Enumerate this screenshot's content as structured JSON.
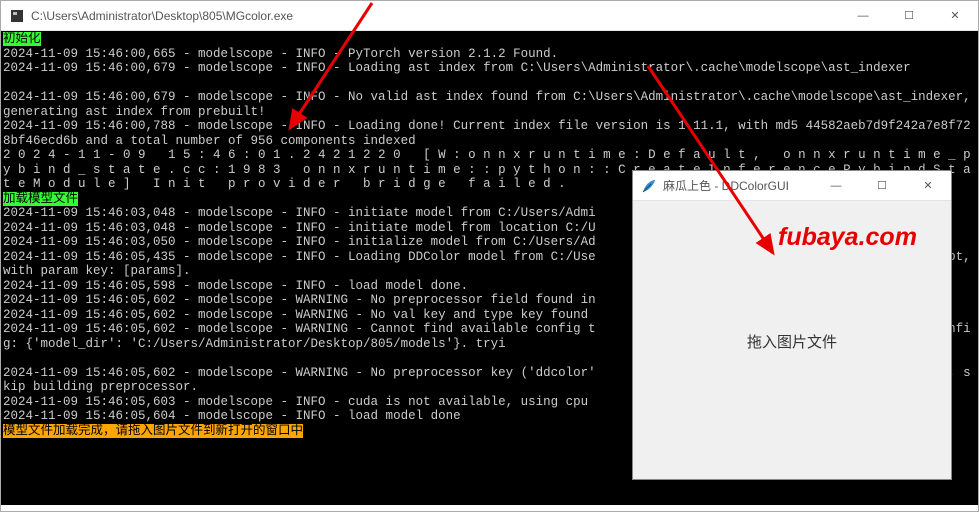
{
  "main_window": {
    "title": "C:\\Users\\Administrator\\Desktop\\805\\MGcolor.exe",
    "controls": {
      "min": "—",
      "max": "☐",
      "close": "✕"
    }
  },
  "console": {
    "hl_init": "初始化",
    "block1": "2024-11-09 15:46:00,665 - modelscope - INFO - PyTorch version 2.1.2 Found.\n2024-11-09 15:46:00,679 - modelscope - INFO - Loading ast index from C:\\Users\\Administrator\\.cache\\modelscope\\ast_indexer\n\n2024-11-09 15:46:00,679 - modelscope - INFO - No valid ast index found from C:\\Users\\Administrator\\.cache\\modelscope\\ast_indexer, generating ast index from prebuilt!\n2024-11-09 15:46:00,788 - modelscope - INFO - Loading done! Current index file version is 1.11.1, with md5 44582aeb7d9f242a7e8f728bf46ecd6b and a total number of 956 components indexed\n2 0 2 4 - 1 1 - 0 9   1 5 : 4 6 : 0 1 . 2 4 2 1 2 2 0   [ W : o n n x r u n t i m e : D e f a u l t ,   o n n x r u n t i m e _ p y b i n d _ s t a t e . c c : 1 9 8 3   o n n x r u n t i m e : : p y t h o n : : C r e a t e I n f e r e n c e P y b i n d S t a t e M o d u l e ]   I n i t   p r o v i d e r   b r i d g e   f a i l e d .",
    "hl_load": "加载模型文件",
    "block2": "2024-11-09 15:46:03,048 - modelscope - INFO - initiate model from C:/Users/Admi\n2024-11-09 15:46:03,048 - modelscope - INFO - initiate model from location C:/U\n2024-11-09 15:46:03,050 - modelscope - INFO - initialize model from C:/Users/Ad\n2024-11-09 15:46:05,435 - modelscope - INFO - Loading DDColor model from C:/Use                                  ytorch_model.pt, with param key: [params].\n2024-11-09 15:46:05,598 - modelscope - INFO - load model done.\n2024-11-09 15:46:05,602 - modelscope - WARNING - No preprocessor field found in\n2024-11-09 15:46:05,602 - modelscope - WARNING - No val key and type key found                                   on.json file.\n2024-11-09 15:46:05,602 - modelscope - WARNING - Cannot find available config t                                  e, current config: {'model_dir': 'C:/Users/Administrator/Desktop/805/models'}. tryi\n\n2024-11-09 15:46:05,602 - modelscope - WARNING - No preprocessor key ('ddcolor'                                   ROCESSOR_MAP, skip building preprocessor.\n2024-11-09 15:46:05,603 - modelscope - INFO - cuda is not available, using cpu\n2024-11-09 15:46:05,604 - modelscope - INFO - load model done",
    "hl_done": "模型文件加载完成，请拖入图片文件到新打开的窗口中"
  },
  "popup": {
    "title": "麻瓜上色 - DDColorGUI",
    "controls": {
      "min": "—",
      "max": "☐",
      "close": "✕"
    },
    "body": "拖入图片文件"
  },
  "watermark": "fubaya.com"
}
